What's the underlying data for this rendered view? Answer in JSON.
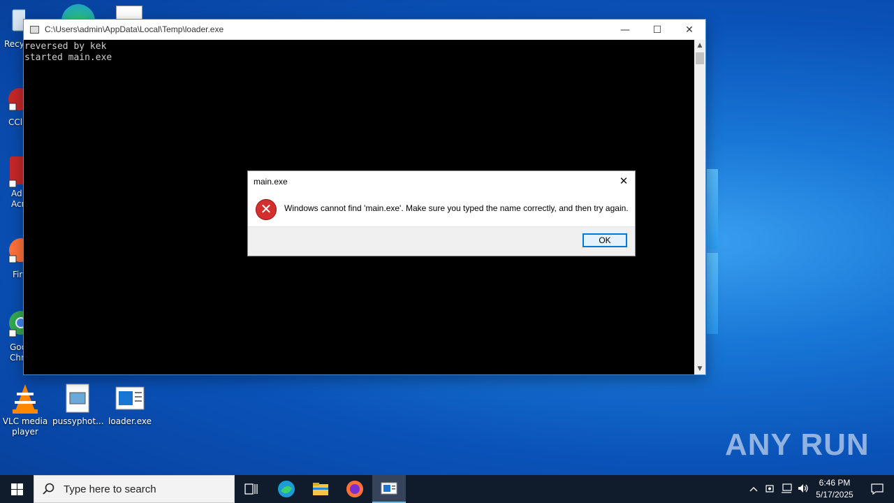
{
  "desktop": {
    "icons": [
      {
        "label": "Recy",
        "icon": "recycle-bin-icon"
      },
      {
        "label": "CCl",
        "icon": "ccleaner-icon"
      },
      {
        "label": "Ad\nAcr",
        "icon": "acrobat-icon"
      },
      {
        "label": "Fir",
        "icon": "firefox-icon"
      },
      {
        "label": "Goo\nChr",
        "icon": "chrome-icon"
      },
      {
        "label": "VLC media player",
        "icon": "vlc-icon"
      },
      {
        "label": "pussyphot...",
        "icon": "image-file-icon"
      },
      {
        "label": "loader.exe",
        "icon": "exe-file-icon"
      }
    ]
  },
  "console": {
    "title": "C:\\Users\\admin\\AppData\\Local\\Temp\\loader.exe",
    "output": "reversed by kek\nstarted main.exe",
    "minimize": "—",
    "maximize": "☐",
    "close": "✕"
  },
  "dialog": {
    "title": "main.exe",
    "close": "✕",
    "icon": "error-icon",
    "message": "Windows cannot find 'main.exe'. Make sure you typed the name correctly, and then try again.",
    "ok_label": "OK"
  },
  "watermark": "ANY RUN",
  "taskbar": {
    "search_placeholder": "Type here to search",
    "apps": [
      "task-view-icon",
      "edge-icon",
      "file-explorer-icon",
      "firefox-icon",
      "console-app-icon"
    ],
    "tray": [
      "chevron-up-icon",
      "security-icon",
      "network-icon",
      "volume-icon"
    ],
    "time": "6:46 PM",
    "date": "5/17/2025",
    "notification": "notification-icon"
  },
  "colors": {
    "accent": "#0078d7",
    "error": "#d32f2f",
    "taskbar": "#101c2c"
  }
}
